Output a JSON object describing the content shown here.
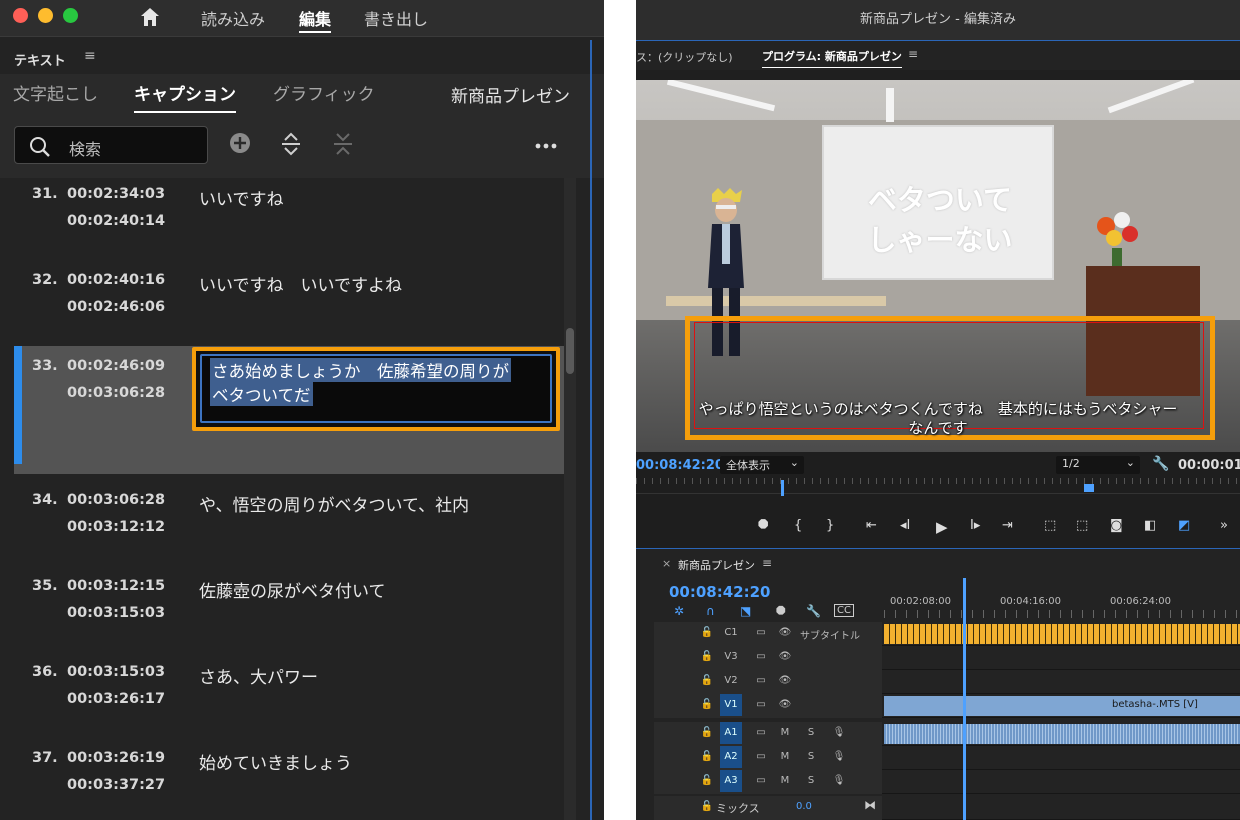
{
  "left": {
    "menubar": {
      "tabs": [
        "読み込み",
        "編集",
        "書き出し"
      ],
      "active": "編集"
    },
    "panel_title": "テキスト",
    "subtabs": [
      "文字起こし",
      "キャプション",
      "グラフィック"
    ],
    "project_name": "新商品プレゼン",
    "search_placeholder": "検索",
    "captions": [
      {
        "num": "31.",
        "start": "00:02:34:03",
        "end": "00:02:40:14",
        "text": "いいですね"
      },
      {
        "num": "32.",
        "start": "00:02:40:16",
        "end": "00:02:46:06",
        "text": "いいですね　いいですよね"
      },
      {
        "num": "33.",
        "start": "00:02:46:09",
        "end": "00:03:06:28",
        "text_line1": "さあ始めましょうか　佐藤希望の周りが",
        "text_line2": "ベタついてだ"
      },
      {
        "num": "34.",
        "start": "00:03:06:28",
        "end": "00:03:12:12",
        "text": "や、悟空の周りがベタついて、社内"
      },
      {
        "num": "35.",
        "start": "00:03:12:15",
        "end": "00:03:15:03",
        "text": "佐藤壺の尿がベタ付いて"
      },
      {
        "num": "36.",
        "start": "00:03:15:03",
        "end": "00:03:26:17",
        "text": "さあ、大パワー"
      },
      {
        "num": "37.",
        "start": "00:03:26:19",
        "end": "00:03:37:27",
        "text": "始めていきましょう"
      }
    ]
  },
  "right": {
    "window_title": "新商品プレゼン - 編集済み",
    "source_tab": "ス：(クリップなし)",
    "program_tab": "プログラム: 新商品プレゼン",
    "slide_line1": "ベタついて",
    "slide_line2": "しゃーない",
    "caption_line1": "やっぱり悟空というのはベタつくんですね　基本的にはもうベタシャー",
    "caption_line2": "なんです",
    "playhead_tc": "00:08:42:20",
    "fit_label": "全体表示",
    "quality_label": "1/2",
    "duration_tc": "00:00:01:",
    "timeline": {
      "tab_close": "×",
      "sequence_name": "新商品プレゼン",
      "timecode": "00:08:42:20",
      "ruler": [
        "00:02:08:00",
        "00:04:16:00",
        "00:06:24:00"
      ],
      "tracks": [
        "C1",
        "V3",
        "V2",
        "V1",
        "A1",
        "A2",
        "A3"
      ],
      "c1_label": "サブタイトル",
      "clip_name": "betasha-.MTS [V]",
      "mix_label": "ミックス",
      "mix_value": "0.0",
      "m_label": "M",
      "s_label": "S"
    }
  },
  "colors": {
    "accent": "#2d8ceb",
    "highlight": "#f59e0b",
    "timecode": "#4ea1ff",
    "caption_clip": "#f2b02f",
    "video_clip": "#7fa6d3"
  }
}
